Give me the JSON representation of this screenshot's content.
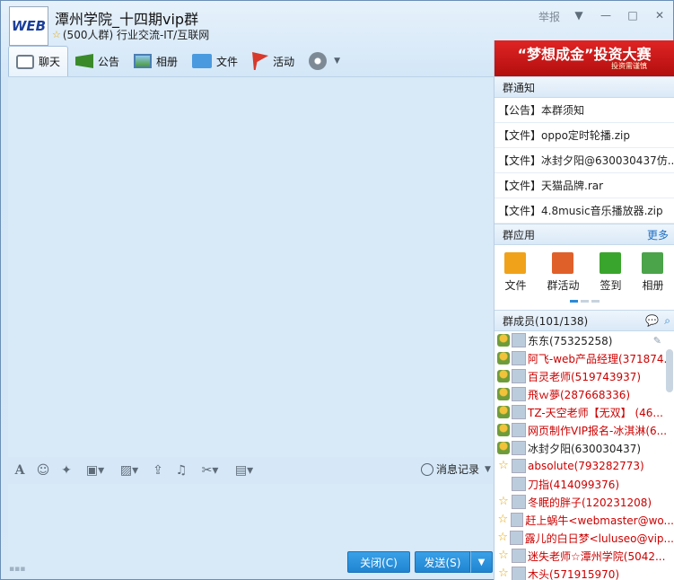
{
  "header": {
    "avatar_text": "WEB",
    "title": "潭州学院_十四期vip群",
    "subtitle": "(500人群) 行业交流-IT/互联网",
    "report_label": "举报"
  },
  "toolbar": {
    "tabs": [
      {
        "label": "聊天",
        "icon": "chat-icon"
      },
      {
        "label": "公告",
        "icon": "notice-icon"
      },
      {
        "label": "相册",
        "icon": "album-icon"
      },
      {
        "label": "文件",
        "icon": "folder-icon"
      },
      {
        "label": "活动",
        "icon": "flag-icon"
      }
    ]
  },
  "input_toolbar": {
    "history_label": "消息记录"
  },
  "buttons": {
    "close_label": "关闭(C)",
    "send_label": "发送(S)"
  },
  "right_panel": {
    "banner_text": "“梦想成金”投资大赛",
    "banner_sub": "投资需谨慎",
    "notice_head": "群通知",
    "notices": [
      "【公告】本群须知",
      "【文件】oppo定时轮播.zip",
      "【文件】冰封夕阳@630030437仿...",
      "【文件】天猫品牌.rar",
      "【文件】4.8music音乐播放器.zip"
    ],
    "apps_head": "群应用",
    "apps_more": "更多",
    "apps": [
      {
        "label": "文件",
        "color": "#f0a21a"
      },
      {
        "label": "群活动",
        "color": "#e0602a"
      },
      {
        "label": "签到",
        "color": "#3aa52c"
      },
      {
        "label": "相册",
        "color": "#4ba34a"
      }
    ],
    "members_head": "群成员(101/138)",
    "members": [
      {
        "name": "东东(75325258)",
        "role": "admin",
        "red": false
      },
      {
        "name": "阿飞-web产品经理(371874...",
        "role": "admin",
        "red": true
      },
      {
        "name": "百灵老师(519743937)",
        "role": "admin",
        "red": true
      },
      {
        "name": "飛ｗ夢(287668336)",
        "role": "admin",
        "red": true
      },
      {
        "name": "TZ-天空老师【无双】 (46...",
        "role": "admin",
        "red": true
      },
      {
        "name": "网页制作VIP报名-冰淇淋(6...",
        "role": "admin",
        "red": true
      },
      {
        "name": "冰封夕阳(630030437)",
        "role": "admin",
        "red": false
      },
      {
        "name": "absolute(793282773)",
        "role": "vip",
        "red": true
      },
      {
        "name": "刀指(414099376)",
        "role": "none",
        "red": true
      },
      {
        "name": "冬眠的胖子(120231208)",
        "role": "vip",
        "red": true
      },
      {
        "name": "赶上蜗牛<webmaster@wo...",
        "role": "vip",
        "red": true
      },
      {
        "name": "露儿的白日梦<luluseo@vip...",
        "role": "vip",
        "red": true
      },
      {
        "name": "迷失老师☆潭州学院(5042...",
        "role": "vip",
        "red": true
      },
      {
        "name": "木头(571915970)",
        "role": "vip",
        "red": true
      }
    ]
  }
}
